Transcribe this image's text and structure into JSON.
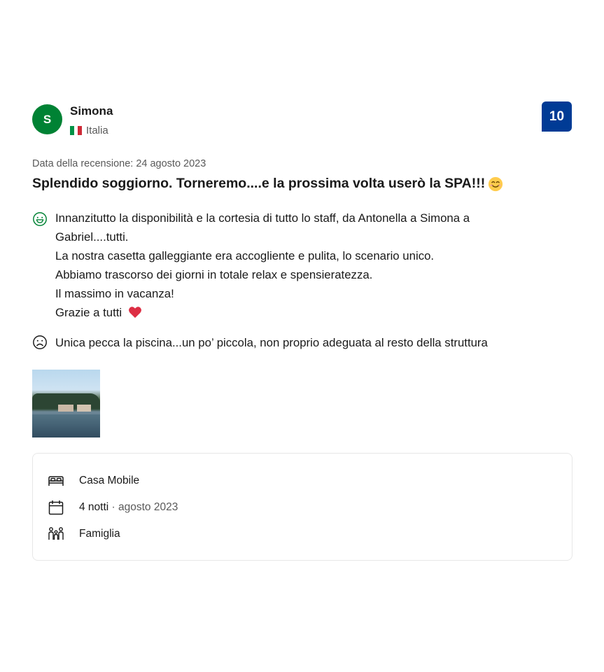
{
  "review": {
    "reviewer_initial": "S",
    "reviewer_name": "Simona",
    "country": "Italia",
    "score": "10",
    "date_text": "Data della recensione: 24 agosto 2023",
    "title": "Splendido soggiorno. Torneremo....e la prossima volta userò la SPA!!!",
    "positive_lines": [
      "Innanzitutto la disponibilità e la cortesia di tutto lo staff, da Antonella a Simona a",
      "Gabriel....tutti.",
      "La nostra casetta galleggiante era accogliente e pulita, lo scenario unico.",
      "Abbiamo trascorso dei giorni in totale relax e spensieratezza.",
      "Il massimo in vacanza!",
      "Grazie a tutti"
    ],
    "negative_text": "Unica pecca la piscina...un po’ piccola, non proprio adeguata al resto della struttura",
    "photo_icon": "review-photo-lake"
  },
  "facts": {
    "room": "Casa Mobile",
    "stay_nights": "4 notti",
    "stay_month": "· agosto 2023",
    "traveler_type": "Famiglia"
  },
  "colors": {
    "avatar_green": "#008234",
    "score_blue": "#003b95",
    "positive_icon": "#008234",
    "text": "#1a1a1a",
    "muted": "#595959"
  }
}
